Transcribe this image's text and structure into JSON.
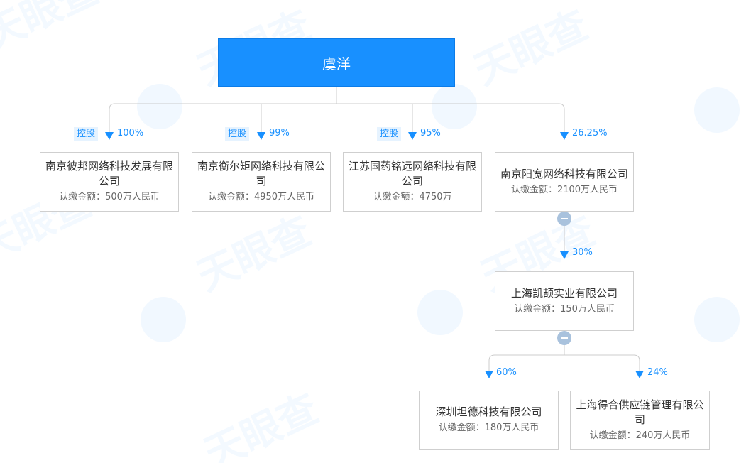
{
  "root": {
    "name": "虞洋"
  },
  "level1": [
    {
      "tag": "控股",
      "percent": "100%",
      "name": "南京彼邦网络科技发展有限公司",
      "amount": "认缴金额：500万人民币"
    },
    {
      "tag": "控股",
      "percent": "99%",
      "name": "南京衡尔矩网络科技有限公司",
      "amount": "认缴金额：4950万人民币"
    },
    {
      "tag": "控股",
      "percent": "95%",
      "name": "江苏国药铭远网络科技有限公司",
      "amount": "认缴金额：4750万"
    },
    {
      "tag": "",
      "percent": "26.25%",
      "name": "南京阳宽网络科技有限公司",
      "amount": "认缴金额：2100万人民币"
    }
  ],
  "level2": {
    "percent": "30%",
    "name": "上海凯颉实业有限公司",
    "amount": "认缴金额：150万人民币"
  },
  "level3": [
    {
      "percent": "60%",
      "name": "深圳坦德科技有限公司",
      "amount": "认缴金额：180万人民币"
    },
    {
      "percent": "24%",
      "name": "上海得合供应链管理有限公司",
      "amount": "认缴金额：240万人民币"
    }
  ],
  "colors": {
    "primary": "#1890ff",
    "line": "#cccccc",
    "collapse": "#a9c2dd"
  },
  "icons": {
    "arrow": "arrow-down-icon",
    "collapse": "minus-circle-icon"
  }
}
